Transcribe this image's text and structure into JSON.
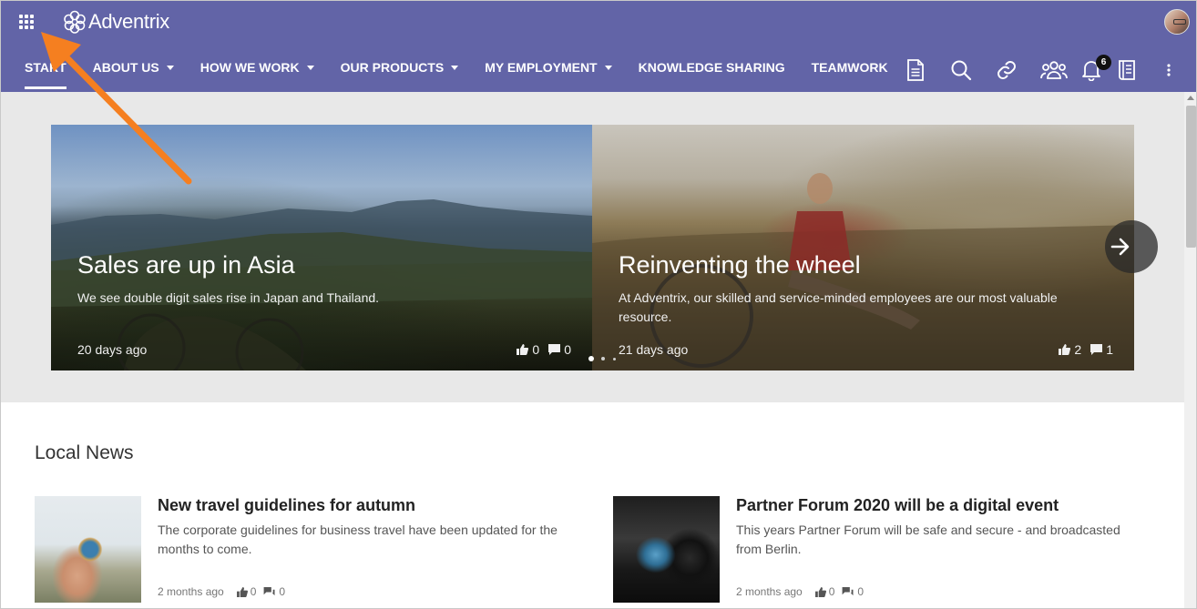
{
  "brand": {
    "name": "Adventrix"
  },
  "nav": {
    "items": [
      {
        "label": "START",
        "has_dropdown": false,
        "active": true
      },
      {
        "label": "ABOUT US",
        "has_dropdown": true
      },
      {
        "label": "HOW WE WORK",
        "has_dropdown": true
      },
      {
        "label": "OUR PRODUCTS",
        "has_dropdown": true
      },
      {
        "label": "MY EMPLOYMENT",
        "has_dropdown": true
      },
      {
        "label": "KNOWLEDGE SHARING",
        "has_dropdown": false
      },
      {
        "label": "TEAMWORK",
        "has_dropdown": false
      }
    ]
  },
  "toolbar": {
    "icons": [
      "document-icon",
      "search-icon",
      "link-icon",
      "people-icon",
      "bell-icon",
      "book-icon",
      "more-vertical-icon"
    ],
    "notification_count": "6"
  },
  "hero": {
    "slides": [
      {
        "title": "Sales are up in Asia",
        "description": "We see double digit sales rise in Japan and Thailand.",
        "date": "20 days ago",
        "likes": "0",
        "comments": "0"
      },
      {
        "title": "Reinventing the wheel",
        "description": "At Adventrix, our skilled and service-minded employees are our most valuable resource.",
        "date": "21 days ago",
        "likes": "2",
        "comments": "1"
      }
    ]
  },
  "local_news": {
    "title": "Local News",
    "items": [
      {
        "title": "New travel guidelines for autumn",
        "description": "The corporate guidelines for business travel have been updated for the months to come.",
        "date": "2 months ago",
        "likes": "0",
        "comments": "0"
      },
      {
        "title": "Partner Forum 2020 will be a digital event",
        "description": "This years Partner Forum will be safe and secure - and broadcasted from Berlin.",
        "date": "2 months ago",
        "likes": "0",
        "comments": "0"
      }
    ]
  },
  "colors": {
    "header": "#6264a7",
    "annotation_arrow": "#f57f20",
    "hero_band": "#e8e8e8"
  }
}
